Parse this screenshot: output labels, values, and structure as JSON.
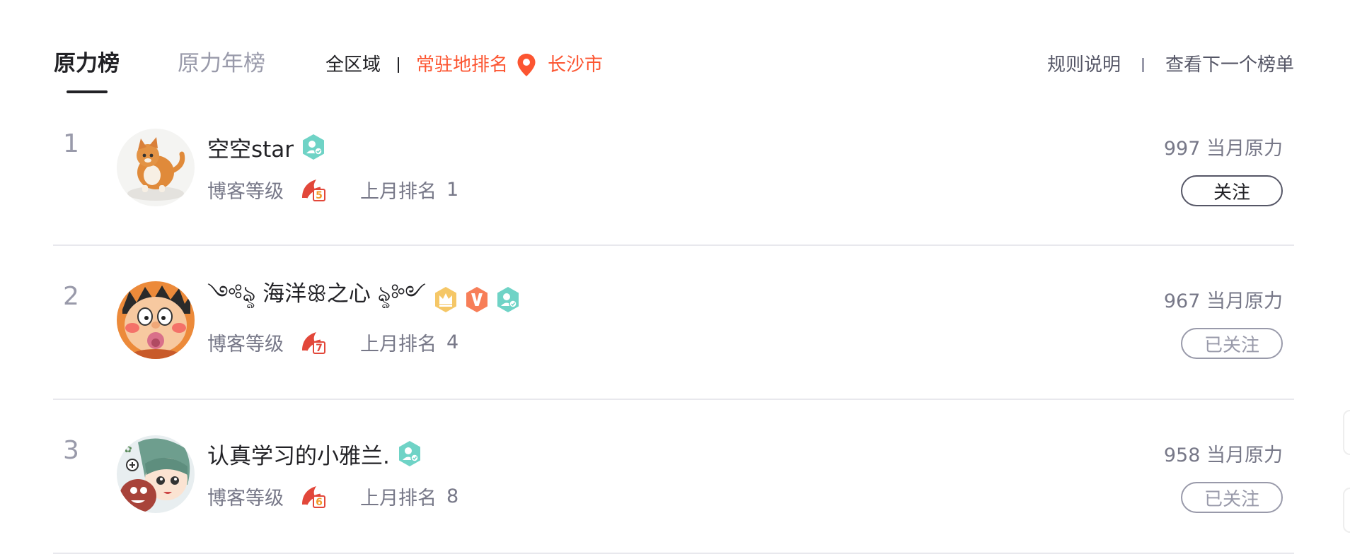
{
  "tabs": [
    {
      "label": "原力榜",
      "active": true
    },
    {
      "label": "原力年榜",
      "active": false
    }
  ],
  "region": {
    "all_label": "全区域",
    "resident_label": "常驻地排名",
    "city": "长沙市"
  },
  "links": {
    "rules": "规则说明",
    "next_board": "查看下一个榜单"
  },
  "rows": [
    {
      "rank": "1",
      "name": "空空star",
      "badges": [
        "user-verified-icon"
      ],
      "level_label": "博客等级",
      "level_icon": "blog-level-5-icon",
      "last_rank_label": "上月排名",
      "last_rank_value": "1",
      "score": "997 当月原力",
      "button": "关注",
      "followed": false
    },
    {
      "rank": "2",
      "name": "༺ৡ 海洋ꕥ之心 ৡ༻",
      "badges": [
        "crown-icon",
        "vip-v-icon",
        "user-verified-icon"
      ],
      "level_label": "博客等级",
      "level_icon": "blog-level-7-icon",
      "last_rank_label": "上月排名",
      "last_rank_value": "4",
      "score": "967 当月原力",
      "button": "已关注",
      "followed": true
    },
    {
      "rank": "3",
      "name": "认真学习的小雅兰.",
      "badges": [
        "user-verified-icon"
      ],
      "level_label": "博客等级",
      "level_icon": "blog-level-6-icon",
      "last_rank_label": "上月排名",
      "last_rank_value": "8",
      "score": "958 当月原力",
      "button": "已关注",
      "followed": true
    }
  ],
  "colors": {
    "accent": "#fc5531",
    "text_primary": "#222226",
    "text_secondary": "#777888",
    "text_muted": "#999aaa",
    "divider": "#e8e8ed"
  }
}
